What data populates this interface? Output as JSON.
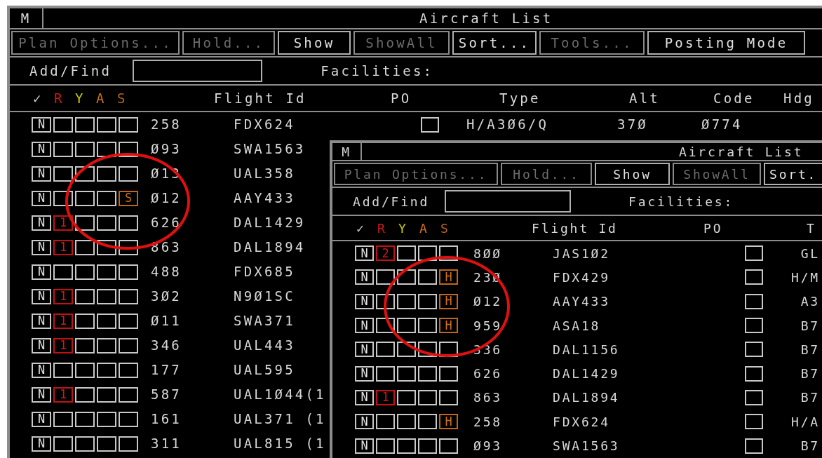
{
  "back_window": {
    "menu": "M",
    "title": "Aircraft List",
    "toolbar": [
      {
        "label": "Plan Options...",
        "disabled": true
      },
      {
        "label": "Hold...",
        "disabled": true
      },
      {
        "label": "Show",
        "disabled": false
      },
      {
        "label": "ShowAll",
        "disabled": true
      },
      {
        "label": "Sort...",
        "disabled": false
      },
      {
        "label": "Tools...",
        "disabled": true
      },
      {
        "label": "Posting Mode",
        "disabled": false
      }
    ],
    "add_find_label": "Add/Find",
    "facilities_label": "Facilities:",
    "flag_headers": [
      {
        "label": "✓",
        "color": "#c8c8c8"
      },
      {
        "label": "R",
        "color": "#d01818"
      },
      {
        "label": "Y",
        "color": "#c8c800"
      },
      {
        "label": "A",
        "color": "#d07018"
      },
      {
        "label": "S",
        "color": "#b8641a"
      }
    ],
    "columns": [
      "Flight Id",
      "PO",
      "Type",
      "Alt",
      "Code",
      "Hdg"
    ],
    "rows": [
      {
        "n": "N",
        "number": "258",
        "flight_id": "FDX624",
        "po": {
          "checked": false
        },
        "type": "H/A3Ø6/Q",
        "alt": "37Ø",
        "code": "Ø774"
      },
      {
        "n": "N",
        "number": "Ø93",
        "flight_id": "SWA1563"
      },
      {
        "n": "N",
        "number": "Ø13",
        "flight_id": "UAL358"
      },
      {
        "n": "N",
        "s": "S",
        "number": "Ø12",
        "flight_id": "AAY433"
      },
      {
        "n": "N",
        "r": "1",
        "number": "626",
        "flight_id": "DAL1429"
      },
      {
        "n": "N",
        "r": "1",
        "number": "863",
        "flight_id": "DAL1894"
      },
      {
        "n": "N",
        "number": "488",
        "flight_id": "FDX685"
      },
      {
        "n": "N",
        "r": "1",
        "number": "3Ø2",
        "flight_id": "N9Ø1SC"
      },
      {
        "n": "N",
        "r": "1",
        "number": "Ø11",
        "flight_id": "SWA371"
      },
      {
        "n": "N",
        "r": "1",
        "number": "346",
        "flight_id": "UAL443"
      },
      {
        "n": "N",
        "number": "177",
        "flight_id": "UAL595"
      },
      {
        "n": "N",
        "r": "1",
        "number": "587",
        "flight_id": "UAL1Ø44(1"
      },
      {
        "n": "N",
        "number": "161",
        "flight_id": "UAL371 (1"
      },
      {
        "n": "N",
        "number": "311",
        "flight_id": "UAL815 (1"
      }
    ]
  },
  "front_window": {
    "menu": "M",
    "title": "Aircraft List",
    "toolbar": [
      {
        "label": "Plan Options...",
        "disabled": true
      },
      {
        "label": "Hold...",
        "disabled": true
      },
      {
        "label": "Show",
        "disabled": false
      },
      {
        "label": "ShowAll",
        "disabled": true
      },
      {
        "label": "Sort.",
        "disabled": false
      }
    ],
    "add_find_label": "Add/Find",
    "facilities_label": "Facilities:",
    "flag_headers": [
      {
        "label": "✓",
        "color": "#c8c8c8"
      },
      {
        "label": "R",
        "color": "#d01818"
      },
      {
        "label": "Y",
        "color": "#c8c800"
      },
      {
        "label": "A",
        "color": "#d07018"
      },
      {
        "label": "S",
        "color": "#b8641a"
      }
    ],
    "columns": [
      "Flight Id",
      "PO",
      "T"
    ],
    "rows": [
      {
        "n": "N",
        "r": "2",
        "number": "8ØØ",
        "flight_id": "JAS1Ø2",
        "po": {
          "checked": false
        },
        "type": "GL"
      },
      {
        "n": "N",
        "s": "H",
        "number": "23Ø",
        "flight_id": "FDX429",
        "po": {
          "checked": false
        },
        "type": "H/M"
      },
      {
        "n": "N",
        "s": "H",
        "number": "Ø12",
        "flight_id": "AAY433",
        "po": {
          "checked": false
        },
        "type": "A3"
      },
      {
        "n": "N",
        "s": "H",
        "number": "959",
        "flight_id": "ASA18",
        "po": {
          "checked": false
        },
        "type": "B7"
      },
      {
        "n": "N",
        "number": "336",
        "flight_id": "DAL1156",
        "po": {
          "checked": false
        },
        "type": "B7"
      },
      {
        "n": "N",
        "number": "626",
        "flight_id": "DAL1429",
        "po": {
          "checked": false
        },
        "type": "B7"
      },
      {
        "n": "N",
        "r": "1",
        "number": "863",
        "flight_id": "DAL1894",
        "po": {
          "checked": false
        },
        "type": "B7"
      },
      {
        "n": "N",
        "s": "H",
        "number": "258",
        "flight_id": "FDX624",
        "po": {
          "checked": false
        },
        "type": "H/A"
      },
      {
        "n": "N",
        "number": "Ø93",
        "flight_id": "SWA1563",
        "po": {
          "checked": false
        },
        "type": "B7"
      }
    ]
  },
  "annotations": [
    {
      "kind": "circle"
    },
    {
      "kind": "circle"
    }
  ]
}
